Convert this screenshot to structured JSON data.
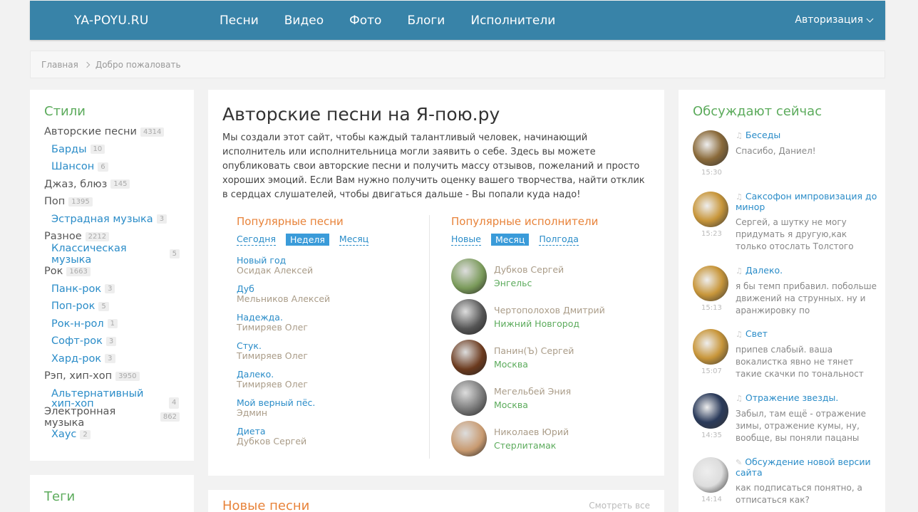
{
  "header": {
    "logo": "YA-POYU.RU",
    "nav": [
      "Песни",
      "Видео",
      "Фото",
      "Блоги",
      "Исполнители"
    ],
    "auth": "Авторизация"
  },
  "breadcrumb": {
    "home": "Главная",
    "current": "Добро пожаловать"
  },
  "styles": {
    "title": "Стили",
    "items": [
      {
        "label": "Авторские песни",
        "count": "4314",
        "sub": false
      },
      {
        "label": "Барды",
        "count": "10",
        "sub": true
      },
      {
        "label": "Шансон",
        "count": "6",
        "sub": true
      },
      {
        "label": "Джаз, блюз",
        "count": "145",
        "sub": false
      },
      {
        "label": "Поп",
        "count": "1395",
        "sub": false
      },
      {
        "label": "Эстрадная музыка",
        "count": "3",
        "sub": true
      },
      {
        "label": "Разное",
        "count": "2212",
        "sub": false
      },
      {
        "label": "Классическая музыка",
        "count": "5",
        "sub": true
      },
      {
        "label": "Рок",
        "count": "1663",
        "sub": false
      },
      {
        "label": "Панк-рок",
        "count": "3",
        "sub": true
      },
      {
        "label": "Поп-рок",
        "count": "5",
        "sub": true
      },
      {
        "label": "Рок-н-рол",
        "count": "1",
        "sub": true
      },
      {
        "label": "Софт-рок",
        "count": "3",
        "sub": true
      },
      {
        "label": "Хард-рок",
        "count": "3",
        "sub": true
      },
      {
        "label": "Рэп, хип-хоп",
        "count": "3950",
        "sub": false
      },
      {
        "label": "Альтернативный хип-хоп",
        "count": "4",
        "sub": true
      },
      {
        "label": "Электронная музыка",
        "count": "862",
        "sub": false
      },
      {
        "label": "Хаус",
        "count": "2",
        "sub": true
      }
    ]
  },
  "tags": {
    "title": "Теги"
  },
  "main": {
    "title": "Авторские песни на Я-пою.ру",
    "intro": "Мы создали этот сайт, чтобы каждый талантливый человек, начинающий исполнитель или исполнительница могли заявить о себе. Здесь вы можете опубликовать свои авторские песни и получить массу отзывов, пожеланий и просто хороших эмоций. Если Вам нужно получить оценку вашего творчества, найти отклик в сердцах слушателей, чтобы двигаться дальше - Вы попали куда надо!",
    "popular_songs": {
      "title": "Популярные песни",
      "filters": [
        "Сегодня",
        "Неделя",
        "Месяц"
      ],
      "active": "Неделя",
      "items": [
        {
          "title": "Новый год",
          "author": "Осидак Алексей"
        },
        {
          "title": "Дуб",
          "author": "Мельников Алексей"
        },
        {
          "title": "Надежда.",
          "author": "Тимиряев Олег"
        },
        {
          "title": "Стук.",
          "author": "Тимиряев Олег"
        },
        {
          "title": "Далеко.",
          "author": "Тимиряев Олег"
        },
        {
          "title": "Мой верный пёс.",
          "author": "Эдмин"
        },
        {
          "title": "Диета",
          "author": "Дубков Сергей"
        }
      ]
    },
    "popular_artists": {
      "title": "Популярные исполнители",
      "filters": [
        "Новые",
        "Месяц",
        "Полгода"
      ],
      "active": "Месяц",
      "items": [
        {
          "name": "Дубков Сергей",
          "city": "Энгельс",
          "color": "#7a9a5a"
        },
        {
          "name": "Чертополохов Дмитрий",
          "city": "Нижний Новгород",
          "color": "#555555"
        },
        {
          "name": "Панин(Ъ) Сергей",
          "city": "Москва",
          "color": "#6b3a1e"
        },
        {
          "name": "Мегельбей Эния",
          "city": "Москва",
          "color": "#777777"
        },
        {
          "name": "Николаев Юрий",
          "city": "Стерлитамак",
          "color": "#c89a70"
        }
      ]
    },
    "new_songs": {
      "title": "Новые песни",
      "see_all": "Смотреть все"
    }
  },
  "discussions": {
    "title": "Обсуждают сейчас",
    "items": [
      {
        "title": "Беседы",
        "text": "Спасибо, Даниел!",
        "time": "15:30",
        "icon": "music-note-icon",
        "color": "#8a6a3a"
      },
      {
        "title": "Саксофон импровизация до минор",
        "text": "Сергей, а шутку не могу придумать я другую,как только отослать Толстого",
        "time": "15:23",
        "icon": "music-note-icon",
        "color": "#c8963a"
      },
      {
        "title": "Далеко.",
        "text": "я бы темп прибавил. побольше движений на струнных. ну и аранжировку по",
        "time": "15:13",
        "icon": "music-note-icon",
        "color": "#c8963a"
      },
      {
        "title": "Свет",
        "text": "припев слабый. ваша вокалистка явно не тянет такие скачки по тональност",
        "time": "15:07",
        "icon": "music-note-icon",
        "color": "#c8963a"
      },
      {
        "title": "Отражение звезды.",
        "text": "Забыл, там ещё - отражение зимы, отражение кумы, ну, вообще, вы поняли пацаны",
        "time": "14:35",
        "icon": "music-note-icon",
        "color": "#2a3a5a"
      },
      {
        "title": "Обсуждение новой версии сайта",
        "text": "как подписаться понятно, а отписаться как?",
        "time": "14:14",
        "icon": "pencil-icon",
        "color": "#dddddd"
      }
    ]
  }
}
